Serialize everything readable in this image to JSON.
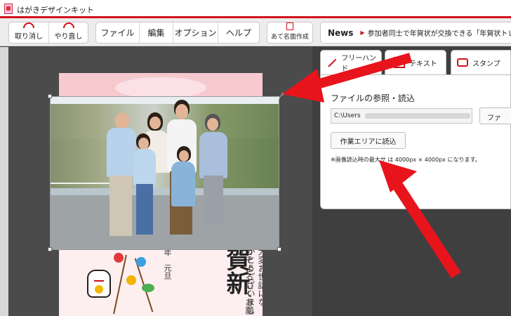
{
  "window": {
    "title": "はがきデザインキット"
  },
  "toolbar": {
    "undo_label": "取り消し",
    "redo_label": "やり直し",
    "menu": [
      "ファイル",
      "編集",
      "オプション",
      "ヘルプ"
    ],
    "address_label": "あて名面作成"
  },
  "news": {
    "label": "News",
    "text": "参加者同士で年賀状が交換できる「年賀状トレード"
  },
  "tabs": [
    {
      "label": "フリーハンド",
      "icon": "pencil-icon"
    },
    {
      "label": "テキスト",
      "icon": "text-icon"
    },
    {
      "label": "スタンプ",
      "icon": "stamp-icon"
    }
  ],
  "panel": {
    "title": "ファイルの参照・読込",
    "path_value": "C:\\Users",
    "browse_label": "ファ",
    "load_label": "作業エリアに読込",
    "note": "※画像読込時の最大サ       は 4000px × 4000px になります。"
  },
  "postcard": {
    "message_col1": "大変お世話にな",
    "message_col2": "がとうございまし",
    "message_col3": "うぞよろしくお願い",
    "big_chars": "賀新",
    "date": "年　元旦"
  },
  "colors": {
    "accent": "#d0101a",
    "arrow": "#e8141c"
  }
}
